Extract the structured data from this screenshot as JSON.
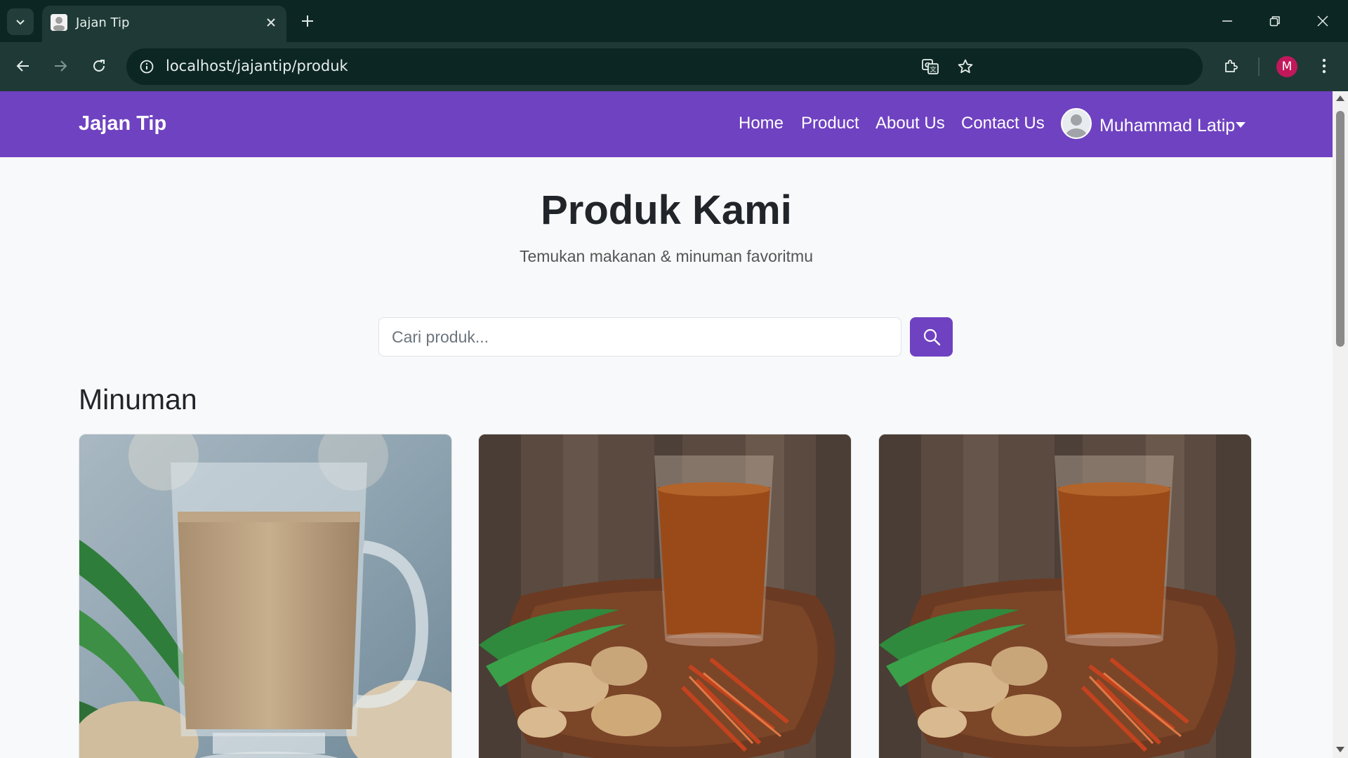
{
  "browser": {
    "tab_title": "Jajan Tip",
    "url": "localhost/jajantip/produk",
    "profile_initial": "M"
  },
  "navbar": {
    "brand": "Jajan Tip",
    "links": [
      "Home",
      "Product",
      "About Us",
      "Contact Us"
    ],
    "user_name": "Muhammad Latip"
  },
  "hero": {
    "title": "Produk Kami",
    "subtitle": "Temukan makanan & minuman favoritmu"
  },
  "search": {
    "placeholder": "Cari produk...",
    "value": ""
  },
  "section": {
    "title": "Minuman"
  },
  "products": [
    {
      "image": "ginger-milk-tea-mug"
    },
    {
      "image": "wedang-jahe-glass-on-tray"
    },
    {
      "image": "wedang-jahe-glass-on-tray"
    }
  ],
  "colors": {
    "primary": "#6f42c1",
    "browser_frame": "#0c2623",
    "browser_toolbar": "#1f3a36",
    "page_bg": "#f8f9fa"
  }
}
